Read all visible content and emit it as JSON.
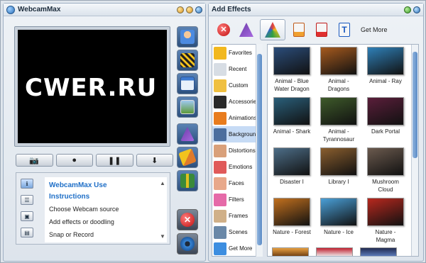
{
  "left_window": {
    "title": "WebcamMax",
    "watermark": "CWER.RU"
  },
  "right_window": {
    "title": "Add Effects",
    "get_more_label": "Get More"
  },
  "instructions": {
    "title_line1": "WebcamMax Use",
    "title_line2": "Instructions",
    "lines": [
      "Choose Webcam source",
      "Add effects or doodling",
      "Snap or Record"
    ]
  },
  "categories": [
    {
      "label": "Favorites",
      "color": "#f2b81e"
    },
    {
      "label": "Recent",
      "color": "#d7dde4"
    },
    {
      "label": "Custom",
      "color": "#f0c040"
    },
    {
      "label": "Accessories",
      "color": "#2a2a2a"
    },
    {
      "label": "Animations",
      "color": "#e87c1e"
    },
    {
      "label": "Backgrounds",
      "color": "#4b6e9e"
    },
    {
      "label": "Distortions",
      "color": "#d9a07a"
    },
    {
      "label": "Emotions",
      "color": "#e05a5a"
    },
    {
      "label": "Faces",
      "color": "#e8a88a"
    },
    {
      "label": "Filters",
      "color": "#e56aa8"
    },
    {
      "label": "Frames",
      "color": "#d0b088"
    },
    {
      "label": "Scenes",
      "color": "#6a88a8"
    },
    {
      "label": "Get More",
      "color": "#3d8ee0"
    }
  ],
  "effects": [
    {
      "label": "Animal - Blue Water Dragon",
      "color": "#2b4d7a"
    },
    {
      "label": "Animal - Dragons",
      "color": "#a65a1e"
    },
    {
      "label": "Animal - Ray",
      "color": "#2f80b8"
    },
    {
      "label": "Animal - Shark",
      "color": "#2a5f7a"
    },
    {
      "label": "Animal - Tyrannosaur",
      "color": "#3e5a2a"
    },
    {
      "label": "Dark Portal",
      "color": "#5a1e3a"
    },
    {
      "label": "Disaster I",
      "color": "#4d6e88"
    },
    {
      "label": "Library I",
      "color": "#8a5e2e"
    },
    {
      "label": "Mushroom Cloud",
      "color": "#6b5a4e"
    },
    {
      "label": "Nature - Forest",
      "color": "#c2701e"
    },
    {
      "label": "Nature - Ice",
      "color": "#4aa0d8"
    },
    {
      "label": "Nature - Magma",
      "color": "#b8281e"
    }
  ],
  "controls": {
    "camera_glyph": "📷",
    "record_glyph": "●",
    "pause_glyph": "❚❚",
    "download_glyph": "⬇"
  }
}
